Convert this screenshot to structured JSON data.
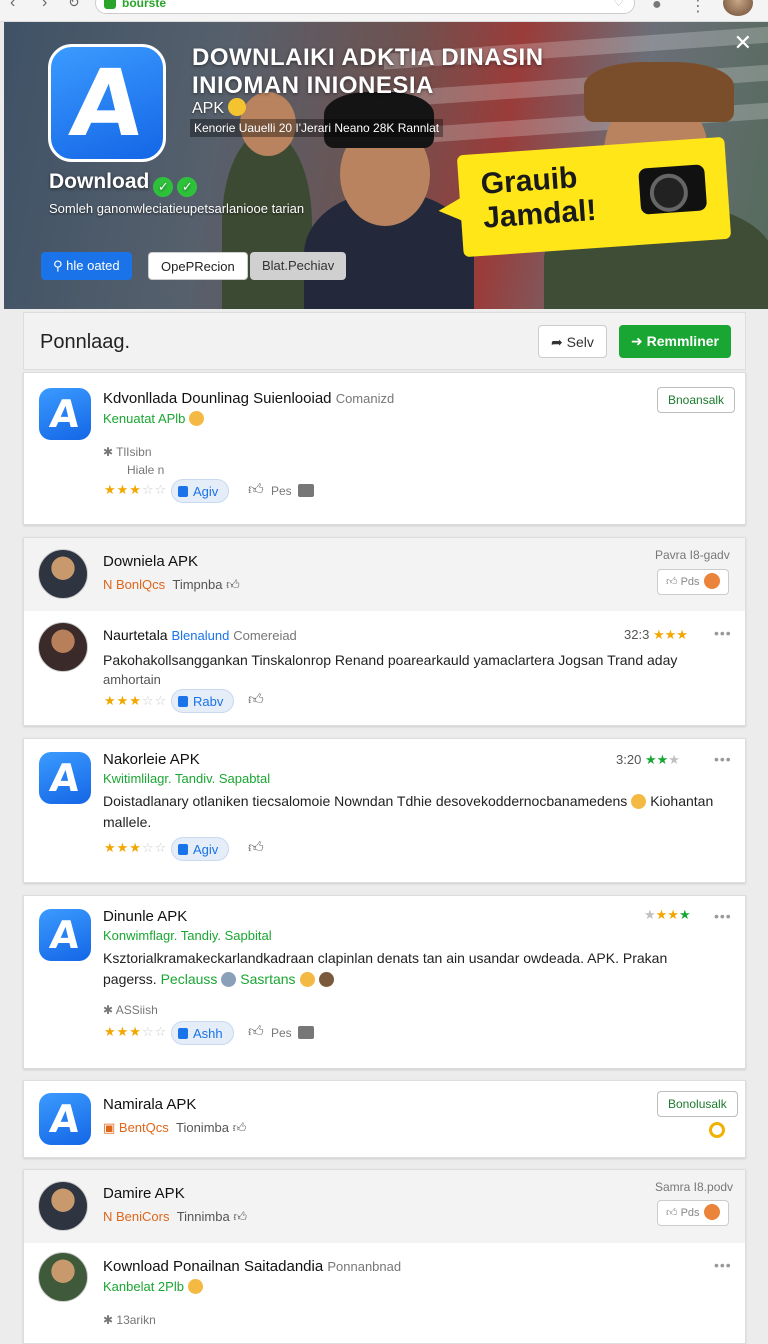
{
  "browser": {
    "address": "bourste"
  },
  "banner": {
    "title_line1": "DOWNLAIKI ADKTIA DINASIN",
    "title_line2": "INIOMAN INIONESIA",
    "apk": "APK",
    "meta": "Kenorie Uauelli 20 I'Jerari Neano 28K Rannlat",
    "download": "Download",
    "desc": "Somleh ganonwleciatieupetsarlaniooe tarian",
    "btn_primary": "hle oated",
    "btn_secondary": "OpePRecion",
    "btn_tertiary": "Blat.Pechiav",
    "callout_line1": "Grauib",
    "callout_line2": "Jamdal!"
  },
  "section": {
    "title": "Ponnlaag.",
    "btn_plain": "Selv",
    "btn_green": "Remmliner"
  },
  "cards": {
    "c1": {
      "title": "Kdvonllada Dounlinag Suienlooiad",
      "title_extra": "Comanizd",
      "subtitle": "Kenuatat APlb",
      "meta1": "TlIsibn",
      "meta2": "Hiale n",
      "pill": "Agiv",
      "action": "Pes",
      "btn": "Bnoansalk"
    },
    "c2": {
      "title": "Downiela APK",
      "meta_a": "BonlQcs",
      "meta_b": "Timpnba",
      "right_label": "Pavra I8-gadv",
      "act": "Pds"
    },
    "c2b": {
      "title": "Naurtetala",
      "title_blue": "Blenalund",
      "title_extra": "Comereiad",
      "time": "32:3",
      "body1": "Pakohakollsanggankan Tinskalonrop Renand poarearkauld yamaclartera Jogsan Trand aday",
      "body2": "amhortain",
      "pill": "Rabv"
    },
    "c3": {
      "title": "Nakorleie APK",
      "subtitle": "Kwitimlilagr. Tandiv. Sapabtal",
      "time": "3:20",
      "body1": "Doistadlanary otlaniken tiecsalomoie Nowndan Tdhie desovekoddernocbanamedens",
      "body_tail": "Kiohantan",
      "body2": "mallele.",
      "pill": "Agiv"
    },
    "c4": {
      "title": "Dinunle APK",
      "subtitle": "Konwimflagr. Tandiy. Sapbital",
      "body1": "Ksztorialkramakeckarlandkadraan clapinlan denats tan ain usandar owdeada. APK. Prakan",
      "body2a": "pagerss.",
      "body2b": "Peclauss",
      "body2c": "Sasrtans",
      "meta": "ASSiish",
      "pill": "Ashh",
      "action": "Pes"
    },
    "c5": {
      "title": "Namirala APK",
      "meta_a": "BentQcs",
      "meta_b": "Tionimba",
      "btn": "Bonolusalk"
    },
    "c6": {
      "title": "Damire APK",
      "meta_a": "BeniCors",
      "meta_b": "Tinnimba",
      "right_label": "Samra I8.podv",
      "act": "Pds"
    },
    "c6b": {
      "title": "Kownload Ponailnan Saitadandia",
      "title_extra": "Ponnanbnad",
      "subtitle": "Kanbelat 2Plb",
      "meta": "13arikn"
    }
  }
}
